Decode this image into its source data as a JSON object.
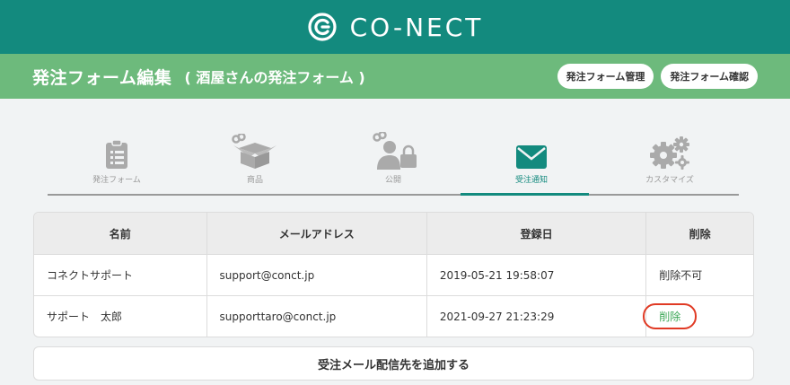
{
  "brand": {
    "logo_text": "CO-NECT"
  },
  "header": {
    "title": "発注フォーム編集",
    "subtitle": "( 酒屋さんの発注フォーム )",
    "buttons": {
      "manage": "発注フォーム管理",
      "confirm": "発注フォーム確認"
    }
  },
  "steps": [
    {
      "label": "発注フォーム",
      "icon": "clipboard-icon",
      "active": false
    },
    {
      "label": "商品",
      "icon": "box-icon",
      "active": false
    },
    {
      "label": "公開",
      "icon": "user-lock-icon",
      "active": false
    },
    {
      "label": "受注通知",
      "icon": "envelope-icon",
      "active": true
    },
    {
      "label": "カスタマイズ",
      "icon": "gears-icon",
      "active": false
    }
  ],
  "table": {
    "columns": [
      "名前",
      "メールアドレス",
      "登録日",
      "削除"
    ],
    "rows": [
      {
        "name": "コネクトサポート",
        "email": "support@conct.jp",
        "date": "2019-05-21 19:58:07",
        "action": "削除不可"
      },
      {
        "name": "サポート　太郎",
        "email": "supporttaro@conct.jp",
        "date": "2021-09-27 21:23:29",
        "action": "削除"
      }
    ]
  },
  "add_button": "受注メール配信先を追加する",
  "colors": {
    "primary": "#138a7e",
    "secondary": "#6dba7c",
    "link": "#3aa655",
    "highlight": "#e03a24"
  }
}
